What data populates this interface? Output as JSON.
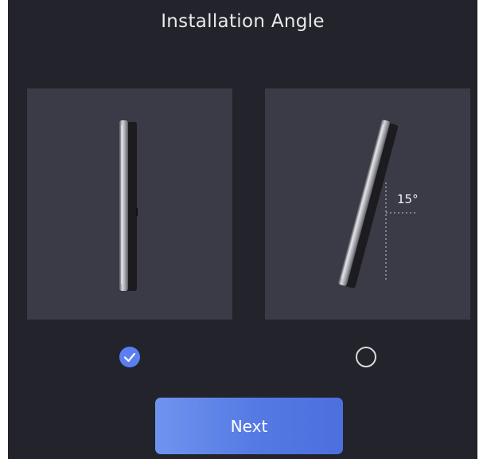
{
  "screen": {
    "title": "Installation Angle",
    "background_color": "#23232b",
    "card_color": "#3b3b47",
    "accent_color": "#5b7ff2"
  },
  "options": [
    {
      "id": "vertical",
      "icon": "device-vertical-icon",
      "selected": true
    },
    {
      "id": "tilted",
      "icon": "device-tilted-icon",
      "angle_label": "15°",
      "selected": false
    }
  ],
  "actions": {
    "next_label": "Next"
  }
}
